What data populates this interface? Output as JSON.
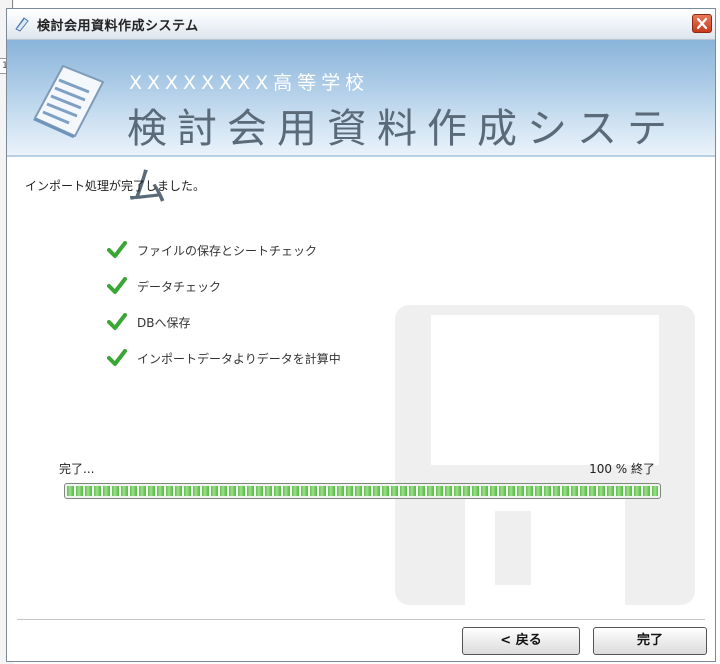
{
  "window": {
    "title": "検討会用資料作成システム",
    "close_icon": "close-icon"
  },
  "header": {
    "subtitle": "XXXXXXXX高等学校",
    "title": "検討会用資料作成システム",
    "icon": "document-icon"
  },
  "status_text": "インポート処理が完了しました。",
  "steps": [
    {
      "label": "ファイルの保存とシートチェック",
      "icon": "check-icon"
    },
    {
      "label": "データチェック",
      "icon": "check-icon"
    },
    {
      "label": "DBへ保存",
      "icon": "check-icon"
    },
    {
      "label": "インポートデータよりデータを計算中",
      "icon": "check-icon"
    }
  ],
  "progress": {
    "label": "完了...",
    "percent_text": "100 % 終了",
    "value": 100
  },
  "buttons": {
    "back": "< 戻る",
    "finish": "完了"
  },
  "background": {
    "tick_text": "1"
  },
  "colors": {
    "accent": "#5fbf4c",
    "header_top": "#8ab4d9",
    "close": "#c63a1c"
  }
}
